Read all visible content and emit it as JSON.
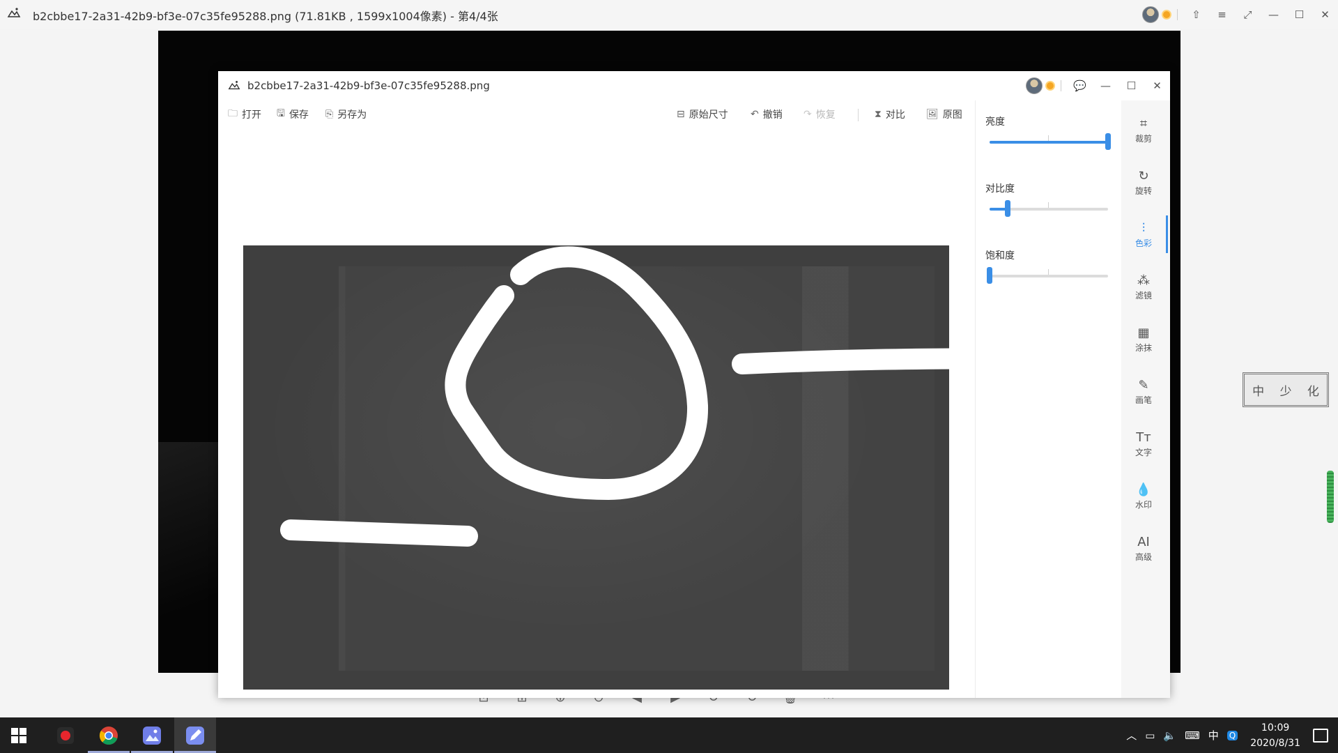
{
  "outer_window": {
    "title": "b2cbbe17-2a31-42b9-bf3e-07c35fe95288.png (71.81KB , 1599x1004像素) - 第4/4张",
    "controls": [
      "pin-icon",
      "menu-icon",
      "fullscreen-icon",
      "minimize-icon",
      "maximize-icon",
      "close-icon"
    ]
  },
  "stamp": {
    "chars": [
      "中",
      "少",
      "化"
    ]
  },
  "editor": {
    "title": "b2cbbe17-2a31-42b9-bf3e-07c35fe95288.png",
    "toolbar": {
      "open": "打开",
      "save": "保存",
      "save_as": "另存为",
      "original_size": "原始尺寸",
      "undo": "撤销",
      "redo": "恢复",
      "compare": "对比",
      "original": "原图"
    },
    "adjust": {
      "brightness": {
        "label": "亮度",
        "value": 1.0
      },
      "contrast": {
        "label": "对比度",
        "value": 0.15
      },
      "saturation": {
        "label": "饱和度",
        "value": 0.0
      }
    },
    "tools": [
      {
        "label": "裁剪",
        "icon": "crop-icon",
        "active": false
      },
      {
        "label": "旋转",
        "icon": "rotate-icon",
        "active": false
      },
      {
        "label": "色彩",
        "icon": "color-icon",
        "active": true
      },
      {
        "label": "滤镜",
        "icon": "filter-icon",
        "active": false
      },
      {
        "label": "涂抹",
        "icon": "smudge-icon",
        "active": false
      },
      {
        "label": "画笔",
        "icon": "brush-icon",
        "active": false
      },
      {
        "label": "文字",
        "icon": "text-icon",
        "active": false
      },
      {
        "label": "水印",
        "icon": "watermark-icon",
        "active": false
      },
      {
        "label": "高级",
        "icon": "ai-icon",
        "active": false,
        "glyph": "AI"
      }
    ]
  },
  "taskbar": {
    "apps": [
      "screen-recorder-icon",
      "chrome-icon",
      "photo-viewer-icon",
      "image-editor-icon"
    ],
    "tray": {
      "ime": "中"
    },
    "clock": {
      "time": "10:09",
      "date": "2020/8/31"
    }
  },
  "colors": {
    "accent": "#3a8ee6",
    "photo": "#3f3f3f"
  }
}
